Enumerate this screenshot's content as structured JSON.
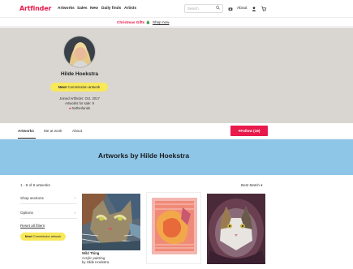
{
  "nav": {
    "logo": "Artfinder",
    "links": [
      "Artworks",
      "Sales",
      "New",
      "Daily finds",
      "Artists"
    ],
    "search_placeholder": "Search",
    "about": "About"
  },
  "promo": {
    "text": "Christmas Gifts 🎄",
    "link": "Shop now"
  },
  "profile": {
    "name": "Hilde Hoekstra",
    "commission_new": "New!",
    "commission_label": "Commission artwork",
    "joined": "Joined Artfinder: Oct. 2017",
    "for_sale": "Artworks for sale: 9",
    "location": "Netherlands"
  },
  "tabs": [
    "Artworks",
    "Me at work",
    "About"
  ],
  "follow": "Follow (19)",
  "header_title": "Artworks by Hilde Hoekstra",
  "listing": {
    "count": "1 - 9 of 9 artworks",
    "sort": "Best Match ▾",
    "filters": [
      "Shop sections",
      "Options"
    ],
    "reset": "Reset all filters",
    "badge_new": "New!",
    "badge_label": "Commission artwork"
  },
  "artworks": [
    {
      "title": "Wild Thing",
      "medium": "Acrylic painting",
      "by": "by Hilde Hoekstra"
    },
    {
      "title": "",
      "medium": "",
      "by": ""
    },
    {
      "title": "",
      "medium": "",
      "by": ""
    }
  ],
  "colors": {
    "brand": "#e8194b",
    "banner": "#d9d6d2",
    "header": "#8ec6e8",
    "badge": "#f8e85a"
  }
}
